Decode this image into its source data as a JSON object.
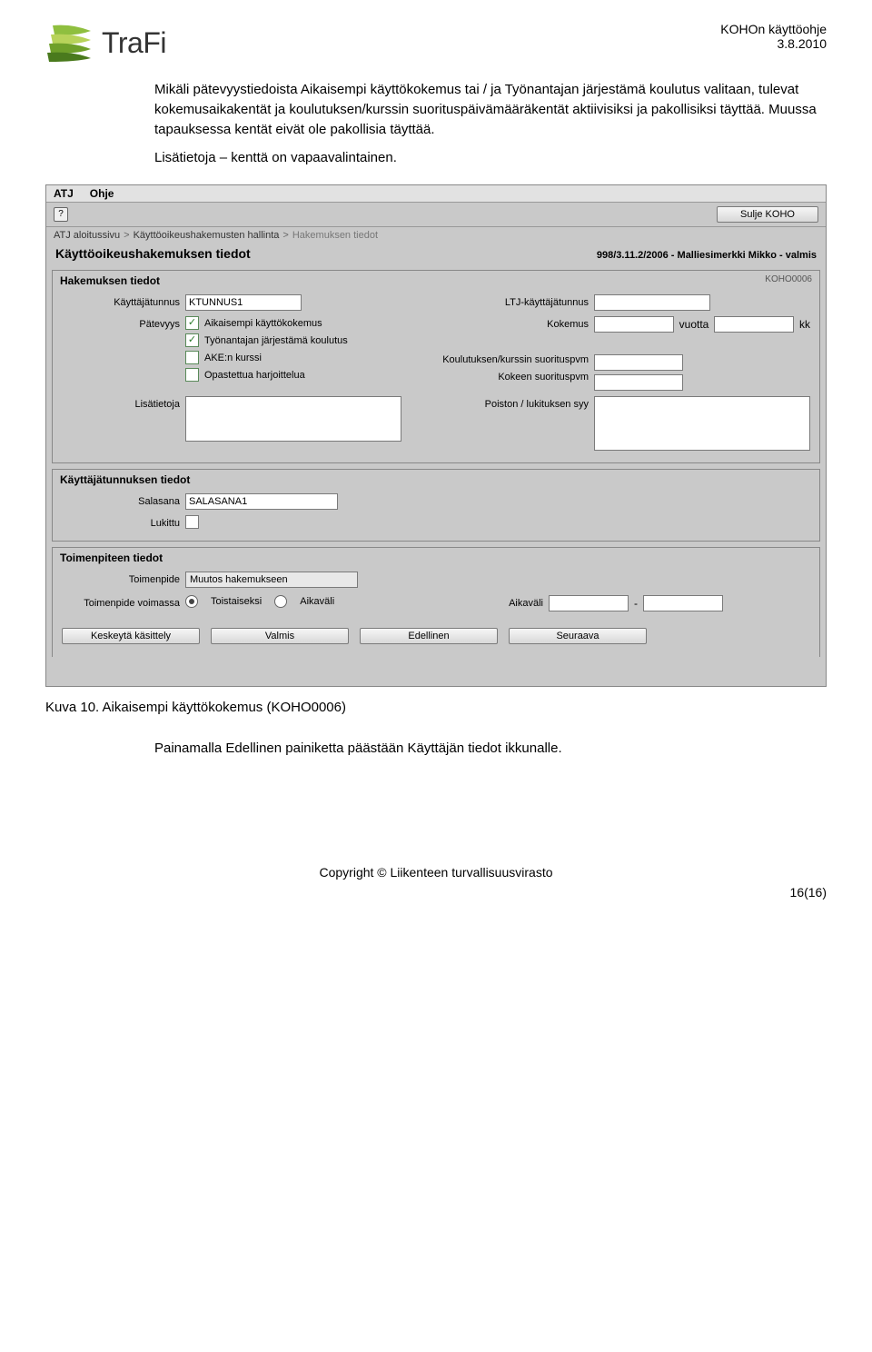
{
  "header": {
    "doc_name": "KOHOn käyttöohje",
    "doc_date": "3.8.2010",
    "logo_text": "TraFi"
  },
  "body": {
    "p1": "Mikäli pätevyystiedoista Aikaisempi käyttökokemus tai / ja Työnantajan järjestämä koulutus valitaan, tulevat kokemusaikakentät ja koulutuksen/kurssin suorituspäivämääräkentät aktiivisiksi ja pakollisiksi täyttää. Muussa tapauksessa kentät eivät ole pakollisia täyttää.",
    "p2": "Lisätietoja – kenttä on vapaavalintainen.",
    "caption": "Kuva 10. Aikaisempi käyttökokemus (KOHO0006)",
    "p3": "Painamalla Edellinen painiketta päästään Käyttäjän tiedot ikkunalle."
  },
  "footer": {
    "copyright": "Copyright © Liikenteen turvallisuusvirasto",
    "pagenum": "16(16)"
  },
  "app": {
    "menu": {
      "atj": "ATJ",
      "ohje": "Ohje"
    },
    "close_btn": "Sulje KOHO",
    "crumbs": {
      "c1": "ATJ aloitussivu",
      "c2": "Käyttöoikeushakemusten hallinta",
      "c3": "Hakemuksen tiedot"
    },
    "page_title": "Käyttöoikeushakemuksen tiedot",
    "page_status": "998/3.11.2/2006 - Malliesimerkki Mikko - valmis",
    "sec1": {
      "title": "Hakemuksen tiedot",
      "code": "KOHO0006",
      "labels": {
        "kayttajatunnus": "Käyttäjätunnus",
        "ltj": "LTJ-käyttäjätunnus",
        "patevyys": "Pätevyys",
        "kokemus": "Kokemus",
        "vuotta": "vuotta",
        "kk": "kk",
        "kurssipvm": "Koulutuksen/kurssin suorituspvm",
        "koepvm": "Kokeen suorituspvm",
        "lisatietoja": "Lisätietoja",
        "poisto": "Poiston / lukituksen syy"
      },
      "values": {
        "kayttajatunnus": "KTUNNUS1"
      },
      "checks": {
        "aik": "Aikaisempi käyttökokemus",
        "tyo": "Työnantajan järjestämä koulutus",
        "ake": "AKE:n kurssi",
        "opa": "Opastettua harjoittelua"
      }
    },
    "sec2": {
      "title": "Käyttäjätunnuksen tiedot",
      "labels": {
        "salasana": "Salasana",
        "lukittu": "Lukittu"
      },
      "values": {
        "salasana": "SALASANA1"
      }
    },
    "sec3": {
      "title": "Toimenpiteen tiedot",
      "labels": {
        "toimenpide": "Toimenpide",
        "voimassa": "Toimenpide voimassa",
        "toistaiseksi": "Toistaiseksi",
        "aikavali": "Aikaväli",
        "aikavali2": "Aikaväli"
      },
      "values": {
        "toimenpide": "Muutos hakemukseen"
      }
    },
    "buttons": {
      "keskeyta": "Keskeytä käsittely",
      "valmis": "Valmis",
      "edellinen": "Edellinen",
      "seuraava": "Seuraava"
    }
  }
}
